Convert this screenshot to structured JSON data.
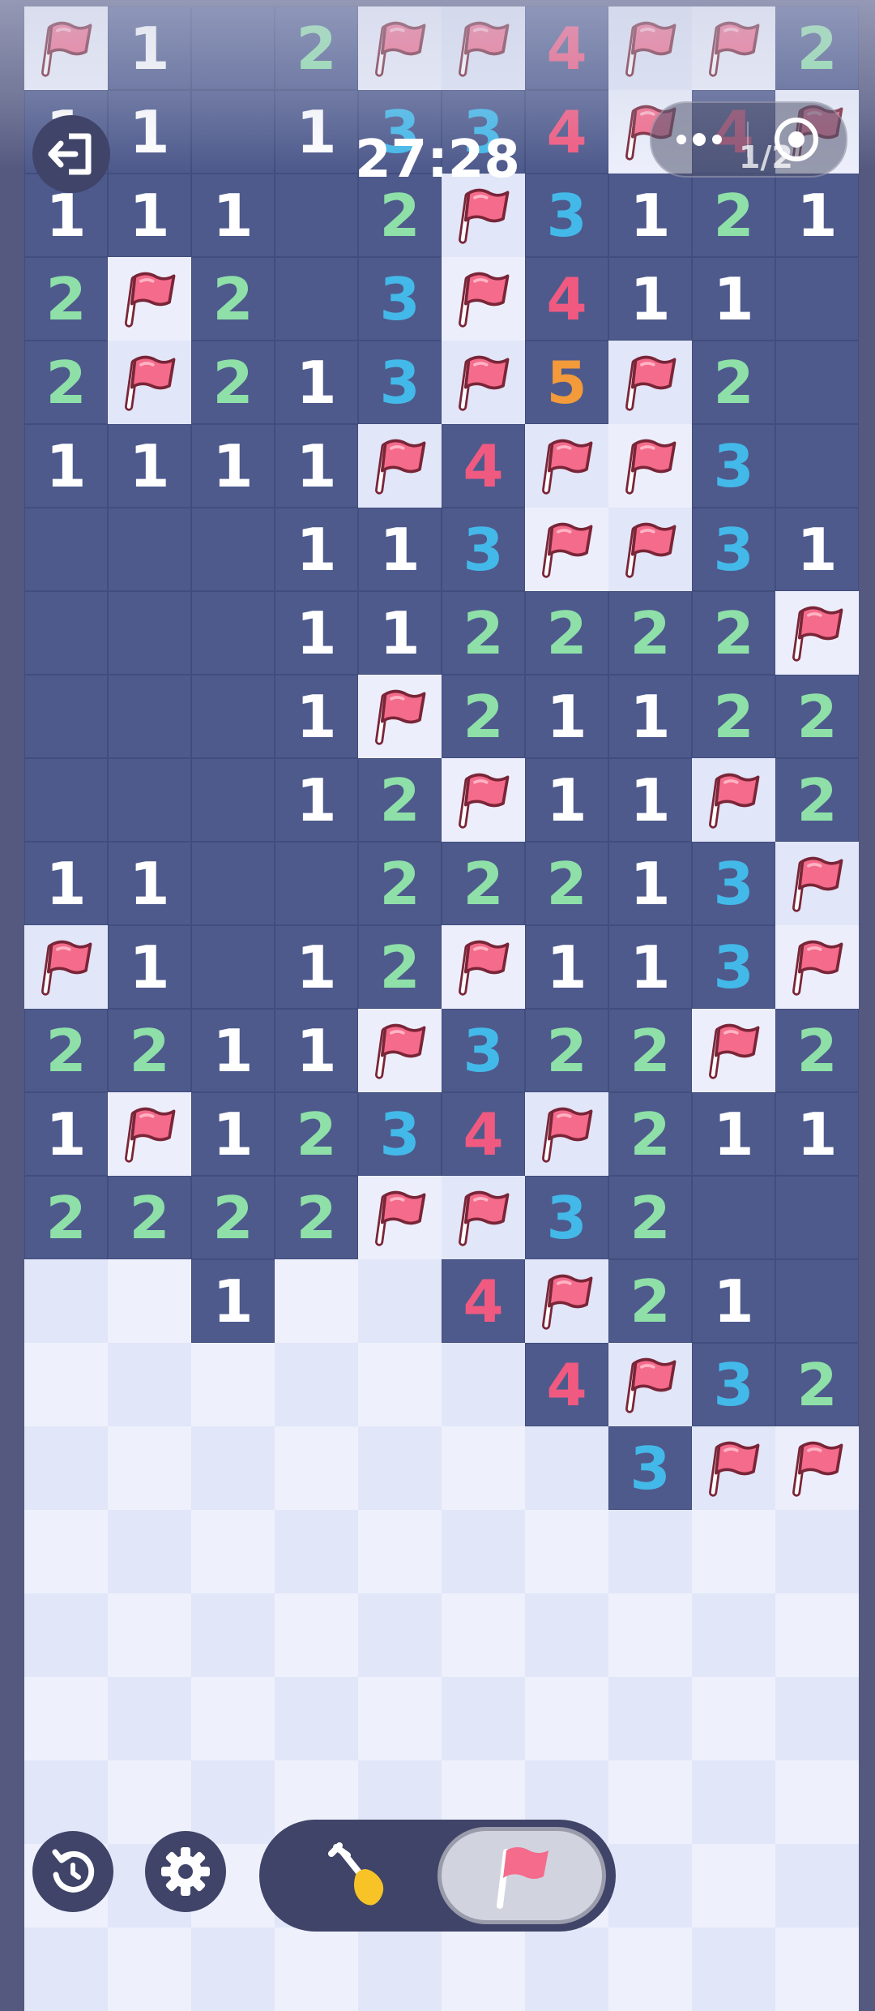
{
  "timer": "27:28",
  "flag_counter": "1/2",
  "icons": {
    "exit": "exit-icon",
    "more": "more-dots-icon",
    "close": "target-circle-icon",
    "undo": "undo-icon",
    "settings": "gear-icon",
    "dig": "shovel-icon",
    "flag": "flag-icon"
  },
  "colors": {
    "revealed": "#4e5a8c",
    "covered_light": "#eef1fc",
    "covered_dark": "#e1e6f8",
    "flag": "#f46b8b",
    "number_1": "#ffffff",
    "number_2": "#8ee0a8",
    "number_3": "#43b9e9",
    "number_4": "#f15a80",
    "number_5": "#f39a3a"
  },
  "board": {
    "columns": 10,
    "legend": "F = flagged, . = covered, _ = revealed empty, digit = adjacent mine count",
    "rows": [
      [
        "F",
        "1",
        "_",
        "2",
        "F",
        "F",
        "4",
        "F",
        "F",
        "2"
      ],
      [
        "1",
        "1",
        "_",
        "1",
        "3",
        "3",
        "4",
        "F",
        "4",
        "F"
      ],
      [
        "1",
        "1",
        "1",
        "_",
        "2",
        "F",
        "3",
        "1",
        "2",
        "1"
      ],
      [
        "2",
        "F",
        "2",
        "_",
        "3",
        "F",
        "4",
        "1",
        "1",
        "_"
      ],
      [
        "2",
        "F",
        "2",
        "1",
        "3",
        "F",
        "5",
        "F",
        "2",
        "_"
      ],
      [
        "1",
        "1",
        "1",
        "1",
        "F",
        "4",
        "F",
        "F",
        "3",
        "_"
      ],
      [
        "_",
        "_",
        "_",
        "1",
        "1",
        "3",
        "F",
        "F",
        "3",
        "1"
      ],
      [
        "_",
        "_",
        "_",
        "1",
        "1",
        "2",
        "2",
        "2",
        "2",
        "F"
      ],
      [
        "_",
        "_",
        "_",
        "1",
        "F",
        "2",
        "1",
        "1",
        "2",
        "2"
      ],
      [
        "_",
        "_",
        "_",
        "1",
        "2",
        "F",
        "1",
        "1",
        "F",
        "2"
      ],
      [
        "1",
        "1",
        "_",
        "_",
        "2",
        "2",
        "2",
        "1",
        "3",
        "F"
      ],
      [
        "F",
        "1",
        "_",
        "1",
        "2",
        "F",
        "1",
        "1",
        "3",
        "F"
      ],
      [
        "2",
        "2",
        "1",
        "1",
        "F",
        "3",
        "2",
        "2",
        "F",
        "2"
      ],
      [
        "1",
        "F",
        "1",
        "2",
        "3",
        "4",
        "F",
        "2",
        "1",
        "1"
      ],
      [
        "2",
        "2",
        "2",
        "2",
        "F",
        "F",
        "3",
        "2",
        "_",
        "_"
      ],
      [
        ".",
        ".",
        "1",
        ".",
        ".",
        "4",
        "F",
        "2",
        "1",
        "_"
      ],
      [
        ".",
        ".",
        ".",
        ".",
        ".",
        ".",
        "4",
        "F",
        "3",
        "2"
      ],
      [
        ".",
        ".",
        ".",
        ".",
        ".",
        ".",
        ".",
        "3",
        "F",
        "F"
      ],
      [
        ".",
        ".",
        ".",
        ".",
        ".",
        ".",
        ".",
        ".",
        ".",
        "."
      ],
      [
        ".",
        ".",
        ".",
        ".",
        ".",
        ".",
        ".",
        ".",
        ".",
        "."
      ],
      [
        ".",
        ".",
        ".",
        ".",
        ".",
        ".",
        ".",
        ".",
        ".",
        "."
      ],
      [
        ".",
        ".",
        ".",
        ".",
        ".",
        ".",
        ".",
        ".",
        ".",
        "."
      ],
      [
        ".",
        ".",
        ".",
        ".",
        ".",
        ".",
        ".",
        ".",
        ".",
        "."
      ],
      [
        ".",
        ".",
        ".",
        ".",
        ".",
        ".",
        ".",
        ".",
        ".",
        "."
      ]
    ]
  }
}
